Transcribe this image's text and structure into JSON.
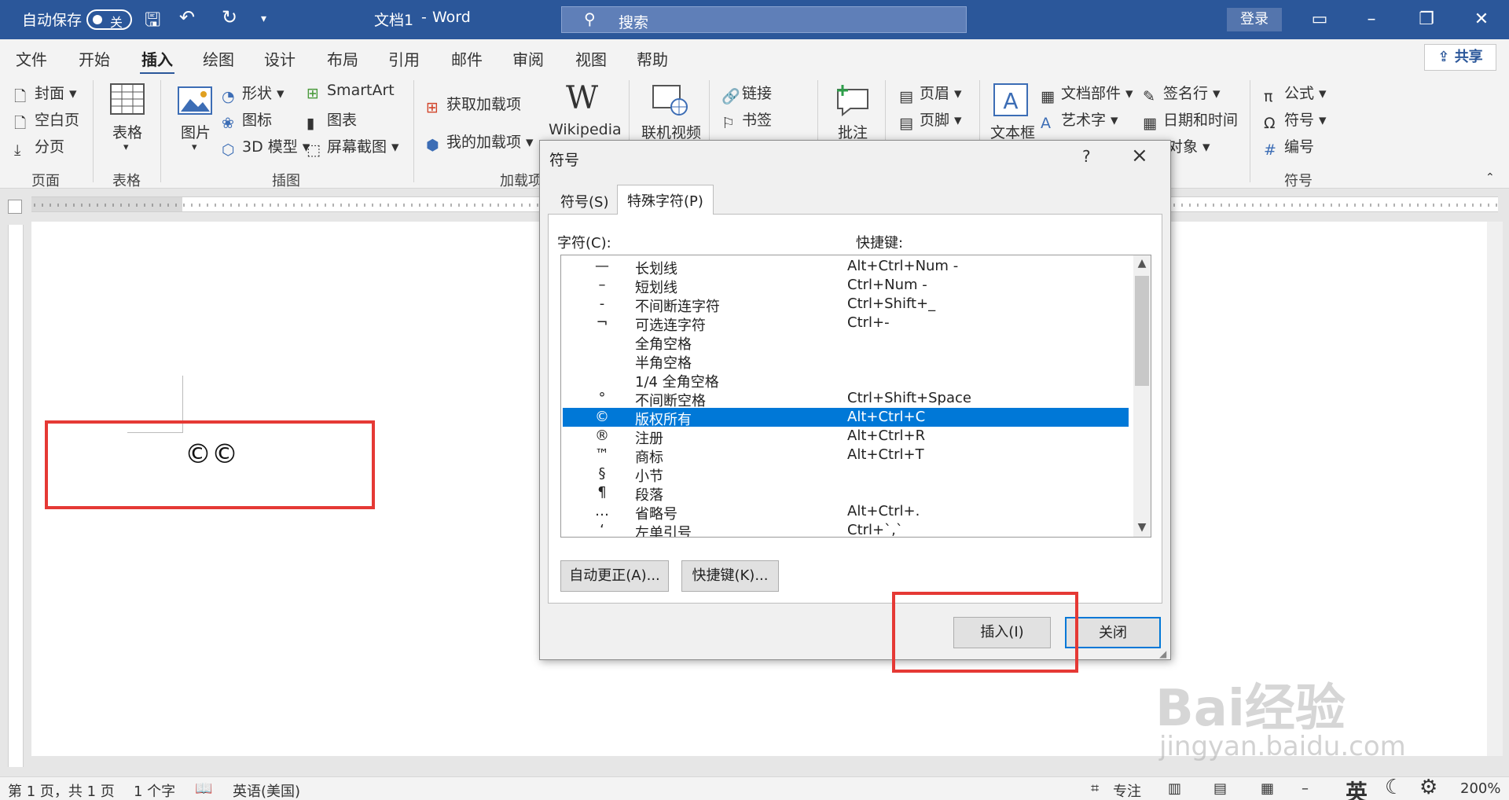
{
  "titlebar": {
    "autosave": "自动保存",
    "toggle": "关",
    "doc_title": "文档1",
    "dash": "-",
    "app": "Word",
    "search": "搜索",
    "login": "登录"
  },
  "tabs": [
    "文件",
    "开始",
    "插入",
    "绘图",
    "设计",
    "布局",
    "引用",
    "邮件",
    "审阅",
    "视图",
    "帮助"
  ],
  "share": "共享",
  "ribbon": {
    "pages": {
      "cover": "封面",
      "blank": "空白页",
      "break": "分页",
      "group": "页面"
    },
    "table": {
      "label": "表格",
      "group": "表格"
    },
    "illustrations": {
      "picture": "图片",
      "shapes": "形状",
      "icons": "图标",
      "model3d": "3D 模型",
      "smartart": "SmartArt",
      "chart": "图表",
      "screenshot": "屏幕截图",
      "group": "插图"
    },
    "addins": {
      "get": "获取加载项",
      "mine": "我的加载项",
      "wikipedia": "Wikipedia",
      "group": "加载项"
    },
    "media": {
      "video": "联机视频"
    },
    "links": {
      "link": "链接",
      "bookmark": "书签"
    },
    "comments": {
      "comment": "批注"
    },
    "header_footer": {
      "header": "页眉",
      "footer": "页脚"
    },
    "text": {
      "textbox": "文本框",
      "parts": "文档部件",
      "wordart": "艺术字",
      "signature": "签名行",
      "datetime": "日期和时间",
      "object": "对象"
    },
    "symbols": {
      "equation": "公式",
      "symbol": "符号",
      "number": "编号",
      "group": "符号"
    }
  },
  "document": {
    "text": "©©"
  },
  "status": {
    "page": "第 1 页，共 1 页",
    "words": "1 个字",
    "lang": "英语(美国)",
    "focus": "专注",
    "ime": "英",
    "zoom": "200%"
  },
  "dialog": {
    "title": "符号",
    "help": "?",
    "tab_symbol": "符号(S)",
    "tab_special": "特殊字符(P)",
    "col_char": "字符(C):",
    "col_key": "快捷键:",
    "rows": [
      {
        "sym": "—",
        "name": "长划线",
        "key": "Alt+Ctrl+Num -"
      },
      {
        "sym": "–",
        "name": "短划线",
        "key": "Ctrl+Num -"
      },
      {
        "sym": "-",
        "name": "不间断连字符",
        "key": "Ctrl+Shift+_"
      },
      {
        "sym": "¬",
        "name": "可选连字符",
        "key": "Ctrl+-"
      },
      {
        "sym": "",
        "name": "全角空格",
        "key": ""
      },
      {
        "sym": "",
        "name": "半角空格",
        "key": ""
      },
      {
        "sym": "",
        "name": "1/4 全角空格",
        "key": ""
      },
      {
        "sym": "°",
        "name": "不间断空格",
        "key": "Ctrl+Shift+Space"
      },
      {
        "sym": "©",
        "name": "版权所有",
        "key": "Alt+Ctrl+C"
      },
      {
        "sym": "®",
        "name": "注册",
        "key": "Alt+Ctrl+R"
      },
      {
        "sym": "™",
        "name": "商标",
        "key": "Alt+Ctrl+T"
      },
      {
        "sym": "§",
        "name": "小节",
        "key": ""
      },
      {
        "sym": "¶",
        "name": "段落",
        "key": ""
      },
      {
        "sym": "…",
        "name": "省略号",
        "key": "Alt+Ctrl+."
      },
      {
        "sym": "‘",
        "name": "左单引号",
        "key": "Ctrl+`,`"
      }
    ],
    "selected_index": 8,
    "btn_autocorrect": "自动更正(A)...",
    "btn_shortcut": "快捷键(K)...",
    "btn_insert": "插入(I)",
    "btn_close": "关闭"
  },
  "watermark": {
    "brand": "Bai经验",
    "url": "jingyan.baidu.com"
  }
}
